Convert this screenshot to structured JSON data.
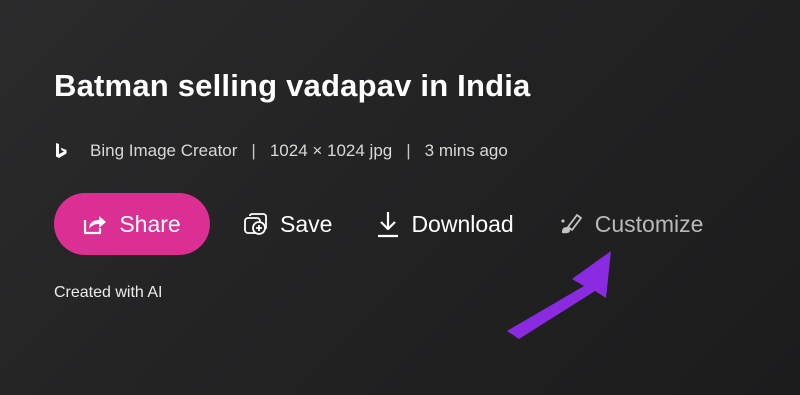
{
  "title": "Batman selling vadapav in India",
  "meta": {
    "source": "Bing Image Creator",
    "separator": "|",
    "dimensions": "1024 × 1024 jpg",
    "time": "3 mins ago"
  },
  "actions": {
    "share": "Share",
    "save": "Save",
    "download": "Download",
    "customize": "Customize"
  },
  "footer_note": "Created with AI",
  "colors": {
    "background": "#232324",
    "share_button": "#dc2f93",
    "annotation_arrow": "#8a2be2",
    "customize_text": "#b9b9b9"
  },
  "icons": {
    "bing": "bing-logo-icon",
    "share": "share-icon",
    "save": "save-collection-icon",
    "download": "download-icon",
    "customize": "customize-brush-icon",
    "annotation": "annotation-arrow"
  }
}
